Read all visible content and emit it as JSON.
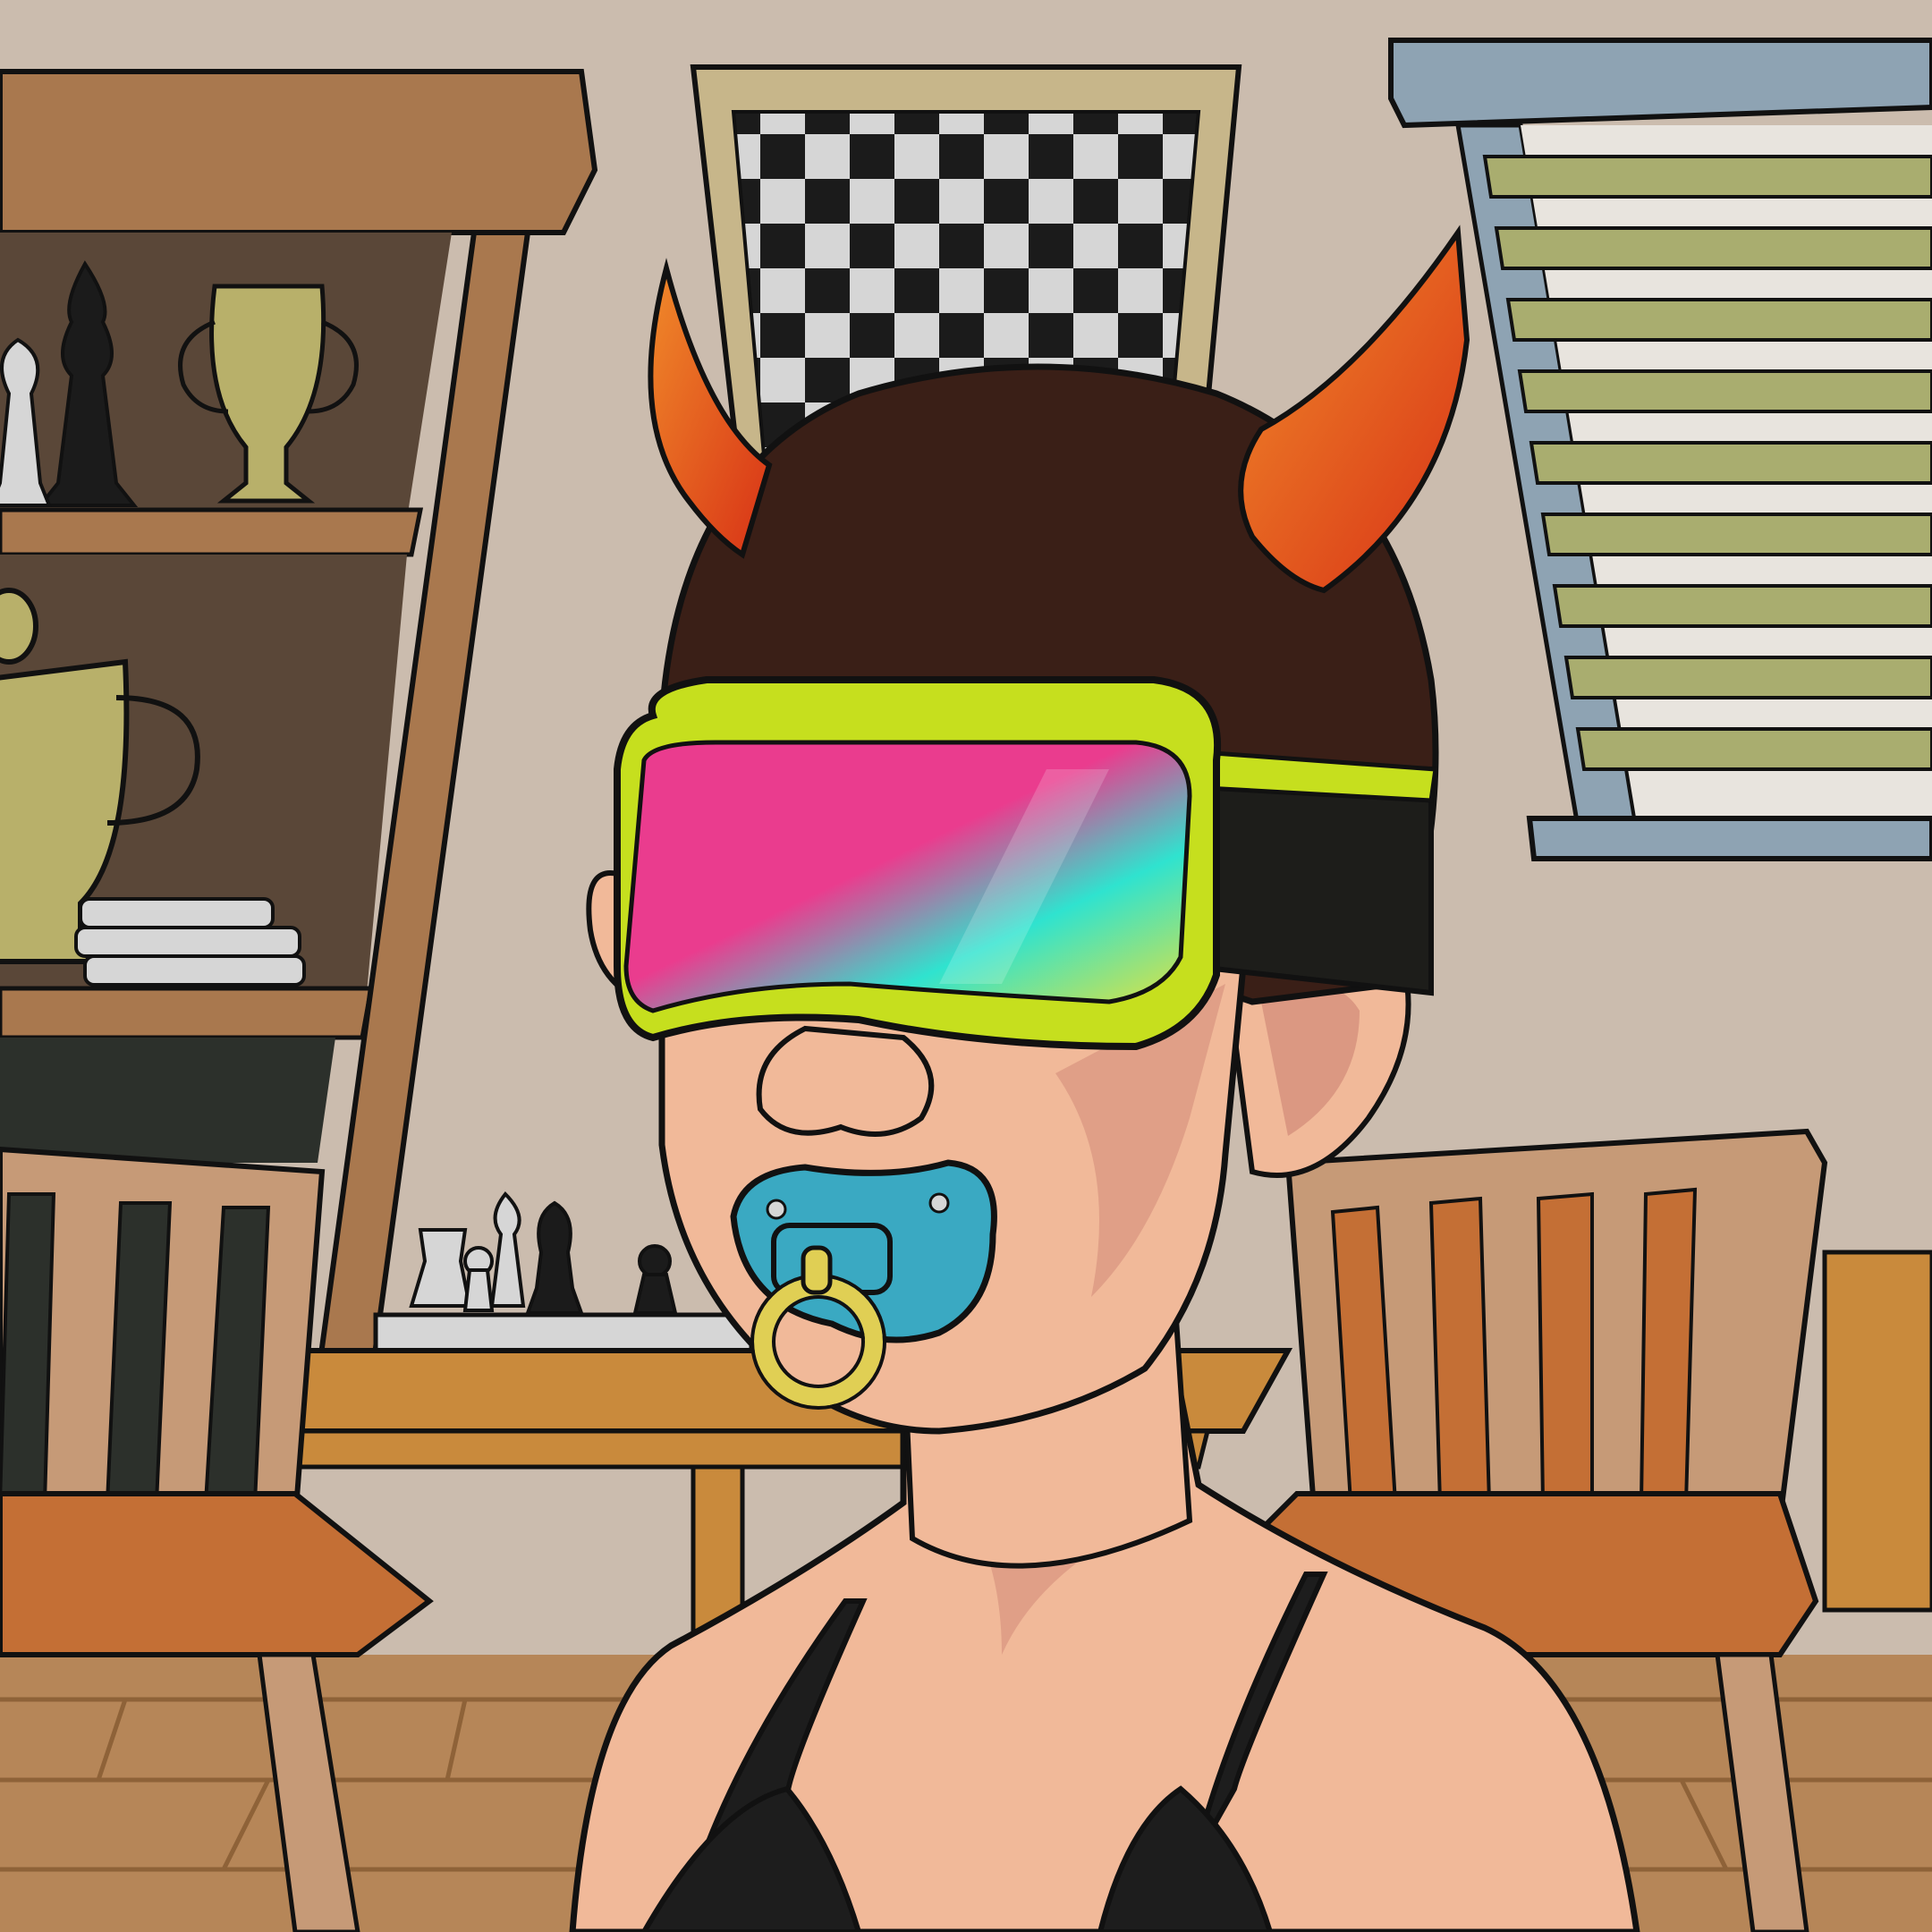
{
  "image": {
    "subject": "cartoon-avatar",
    "colors": {
      "wall": "#cbbcae",
      "floor": "#b68658",
      "floor_line": "#8e6238",
      "shelf_wood": "#a9784e",
      "shelf_dark": "#5a4738",
      "chalkboard": "#2c302b",
      "trophy_gold": "#b8b06a",
      "chess_black": "#1b1b1b",
      "chess_white": "#d6d6d6",
      "chess_frame": "#c7b68a",
      "blind_frame": "#8ea3b3",
      "blind_slat": "#a9ad6f",
      "blind_slat_light": "#e8e4de",
      "table_wood": "#c98a3c",
      "chair_wood": "#c69a77",
      "chair_seat": "#c46f35",
      "skin": "#f1b999",
      "skin_shadow": "#d28a78",
      "hair": "#3a1f17",
      "horn_red": "#d83216",
      "horn_orange": "#f08a2a",
      "goggle_frame": "#c6df1e",
      "goggle_strap": "#1d1d1a",
      "lens_pink": "#ea3c8e",
      "lens_teal": "#2fe3cf",
      "lens_yellow": "#e8e23a",
      "pacifier_blue": "#3aa9c2",
      "pacifier_ring": "#e0cf54",
      "top_black": "#1d1d1d",
      "outline": "#111111"
    }
  }
}
